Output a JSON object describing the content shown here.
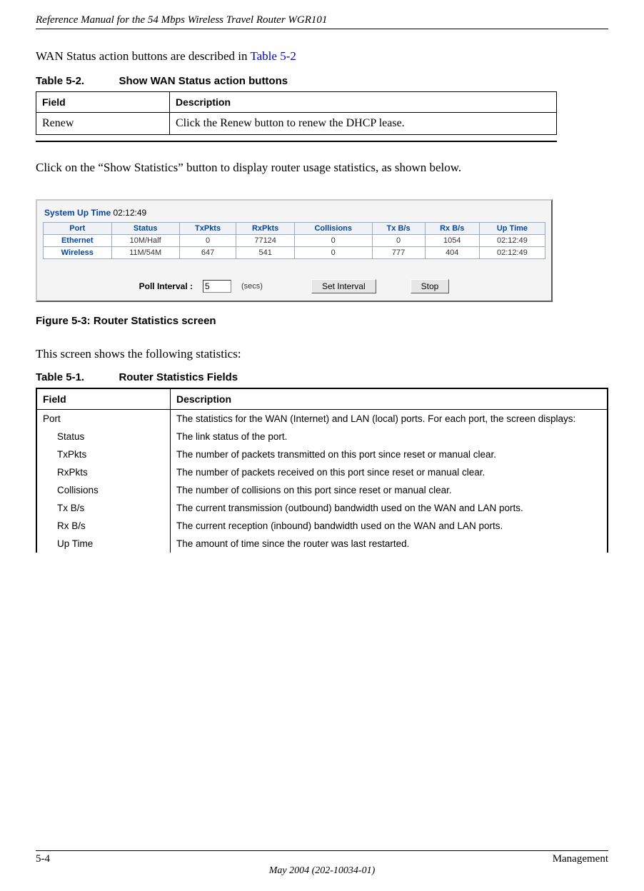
{
  "header": {
    "title": "Reference Manual for the 54 Mbps Wireless Travel Router WGR101"
  },
  "intro1_prefix": "WAN Status action buttons are described in ",
  "intro1_link": "Table 5-2",
  "table52": {
    "caption_num": "Table 5-2.",
    "caption_title": "Show WAN Status action buttons",
    "head_field": "Field",
    "head_desc": "Description",
    "row_field": "Renew",
    "row_desc": "Click the Renew button to renew the DHCP lease."
  },
  "intro2": "Click on the “Show Statistics” button to display router usage statistics, as shown below.",
  "stats_panel": {
    "sysup_label": "System Up Time",
    "sysup_value": "02:12:49",
    "headers": {
      "port": "Port",
      "status": "Status",
      "tx": "TxPkts",
      "rx": "RxPkts",
      "col": "Collisions",
      "txb": "Tx B/s",
      "rxb": "Rx B/s",
      "up": "Up Time"
    },
    "rows": [
      {
        "port": "Ethernet",
        "status": "10M/Half",
        "tx": "0",
        "rx": "77124",
        "col": "0",
        "txb": "0",
        "rxb": "1054",
        "up": "02:12:49"
      },
      {
        "port": "Wireless",
        "status": "11M/54M",
        "tx": "647",
        "rx": "541",
        "col": "0",
        "txb": "777",
        "rxb": "404",
        "up": "02:12:49"
      }
    ],
    "poll_label": "Poll Interval :",
    "poll_value": "5",
    "secs": "(secs)",
    "btn_set": "Set Interval",
    "btn_stop": "Stop"
  },
  "fig_caption": "Figure 5-3:  Router Statistics screen",
  "intro3": "This screen shows the following statistics:",
  "table51": {
    "caption_num": "Table 5-1.",
    "caption_title": "Router Statistics Fields",
    "head_field": "Field",
    "head_desc": "Description",
    "rows": [
      {
        "field": "Port",
        "indent": false,
        "desc": "The statistics for the WAN (Internet) and LAN (local) ports. For each port, the screen displays:"
      },
      {
        "field": "Status",
        "indent": true,
        "desc": "The link status of the port."
      },
      {
        "field": "TxPkts",
        "indent": true,
        "desc": "The number of packets transmitted on this port since reset or manual clear."
      },
      {
        "field": "RxPkts",
        "indent": true,
        "desc": "The number of packets received on this port since reset or manual clear."
      },
      {
        "field": "Collisions",
        "indent": true,
        "desc": "The number of collisions on this port since reset or manual clear."
      },
      {
        "field": "Tx B/s",
        "indent": true,
        "desc": "The current transmission (outbound) bandwidth used on the WAN and LAN ports."
      },
      {
        "field": "Rx B/s",
        "indent": true,
        "desc": "The current reception (inbound) bandwidth used on the WAN and LAN ports."
      },
      {
        "field": "Up Time",
        "indent": true,
        "desc": "The amount of time since the router was last restarted."
      }
    ]
  },
  "footer": {
    "left": "5-4",
    "right": "Management",
    "center": "May 2004 (202-10034-01)"
  }
}
